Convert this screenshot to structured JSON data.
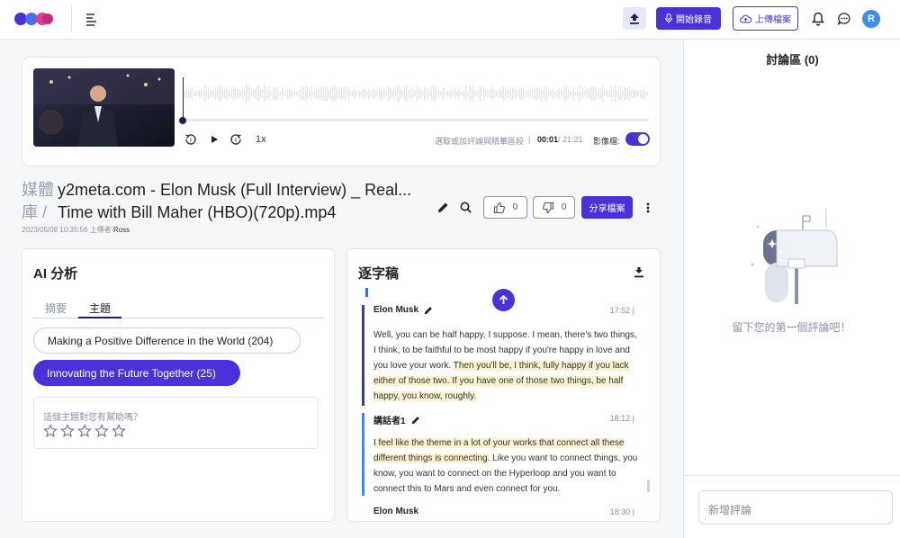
{
  "header": {
    "record_label": "開始錄音",
    "upload_label": "上傳檔案",
    "avatar_initial": "R"
  },
  "player": {
    "speed": "1x",
    "hint": "選取或加評論與精華區段",
    "separator": "|",
    "current_time": "00:01",
    "total_time": "/ 21:21",
    "video_label": "影像檔:",
    "video_toggle": true,
    "progress": 0.001
  },
  "media": {
    "prefix": "媒體庫 /",
    "title": "y2meta.com - Elon Musk (Full Interview) _ Real... Time with Bill Maher (HBO)(720p).mp4",
    "date": "2023/05/08 10:35:56 上傳者",
    "uploader": "Ross",
    "likes": "0",
    "dislikes": "0",
    "share_label": "分享檔案"
  },
  "ai": {
    "title": "AI 分析",
    "tabs": [
      "摘要",
      "主題"
    ],
    "active_tab": "主題",
    "topics": [
      "Making a Positive Difference in the World (204)",
      "Innovating the Future Together (25)"
    ],
    "feedback_question": "這個主題對您有幫助嗎？",
    "star_count": 5
  },
  "transcript": {
    "title": "逐字稿",
    "segments": [
      {
        "speaker": "Elon Musk",
        "time": "17:52 |",
        "text_plain": "Well, you can be half happy, I suppose. I mean, there's two things, I think, to be faithful to be most happy if you're happy in love and you love your work. ",
        "text_highlight": "Then you'll be, I think, fully happy if you lack either of those two. If you have one of those two things, be half happy, you know, roughly."
      },
      {
        "speaker": "講話者1",
        "time": "18:12 |",
        "text_highlight": "I feel like the theme in a lot of your works that connect all these different things is connecting.",
        "text_plain": " Like you want to connect things, you know, you want to connect on the Hyperloop and you want to connect this to Mars and even connect for you."
      }
    ],
    "next_speaker": "Elon Musk",
    "next_time": "18:30 |"
  },
  "discussion": {
    "title": "討論區 (0)",
    "empty_text": "留下您的第一個評論吧！",
    "add_placeholder": "新增評論"
  },
  "colors": {
    "accent": "#4a32d8",
    "navy": "#1c1f5e",
    "highlight": "#fdf2d0",
    "seg_bar_1": "#3a3f8a",
    "seg_bar_2": "#3a8fe8"
  }
}
